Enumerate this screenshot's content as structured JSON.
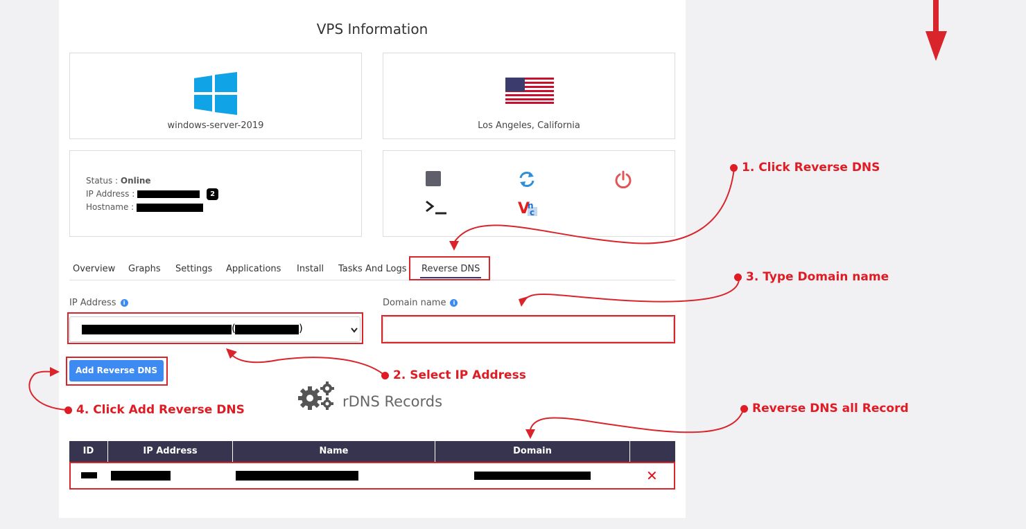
{
  "page_title": "VPS Information",
  "os": {
    "name": "windows-server-2019",
    "icon": "windows-logo-icon"
  },
  "location": {
    "name": "Los Angeles, California",
    "icon": "us-flag-icon"
  },
  "server": {
    "status_label": "Status : ",
    "status_value": "Online",
    "ip_label": "IP Address : ",
    "ip_count_badge": "2",
    "hostname_label": "Hostname : "
  },
  "actions": [
    "stop-icon",
    "reboot-icon",
    "power-icon",
    "console-icon",
    "vnc-icon"
  ],
  "tabs": [
    {
      "label": "Overview"
    },
    {
      "label": "Graphs"
    },
    {
      "label": "Settings"
    },
    {
      "label": "Applications"
    },
    {
      "label": "Install"
    },
    {
      "label": "Tasks And Logs"
    },
    {
      "label": "Reverse DNS",
      "active": true
    }
  ],
  "form": {
    "ip_label": "IP Address",
    "domain_label": "Domain name",
    "domain_value": "",
    "submit_label": "Add Reverse DNS"
  },
  "records": {
    "title": "rDNS Records",
    "columns": [
      "ID",
      "IP Address",
      "Name",
      "Domain",
      ""
    ],
    "delete_symbol": "✕"
  },
  "annotations": {
    "step1": "1. Click Reverse DNS",
    "step2": "2. Select IP Address",
    "step3": "3. Type Domain name",
    "step4": "4. Click Add Reverse DNS",
    "all_records": "Reverse DNS all Record"
  },
  "colors": {
    "accent_blue": "#3d8bf2",
    "annotation_red": "#e01b23",
    "table_header": "#373450",
    "online_green": "#555555"
  }
}
